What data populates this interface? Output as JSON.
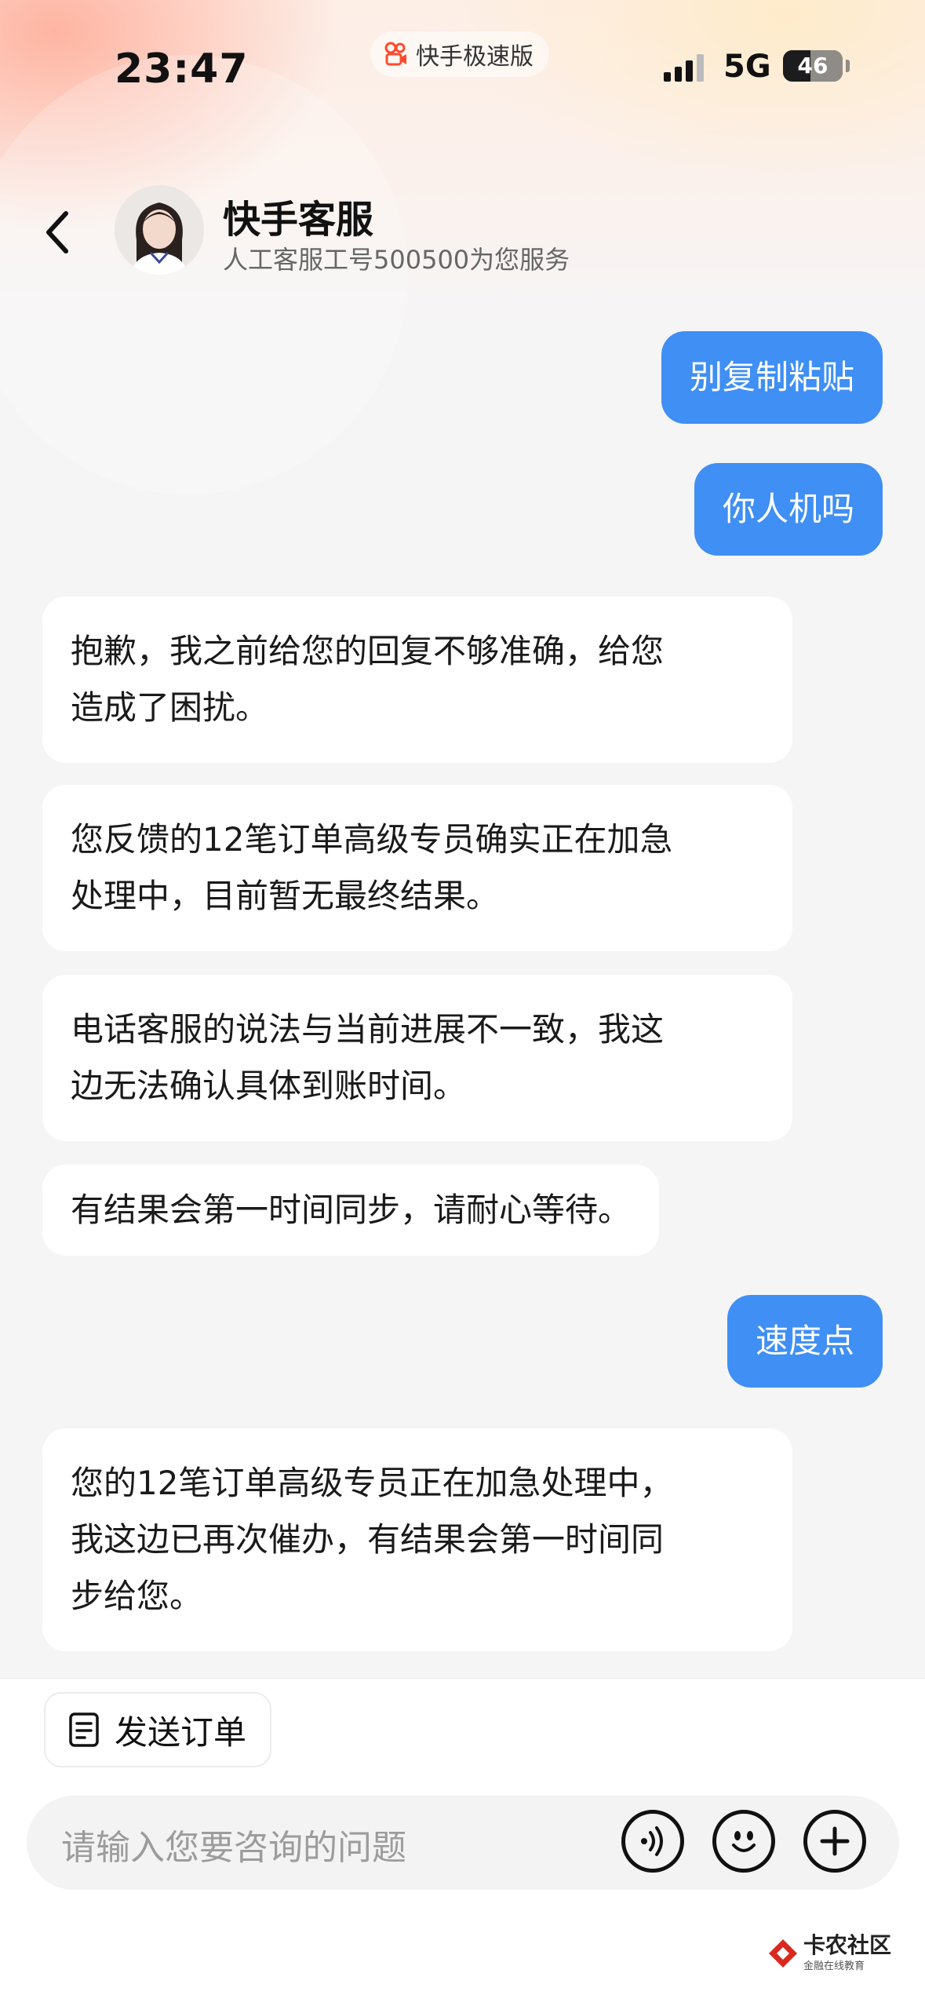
{
  "status_bar": {
    "time": "23:47",
    "app_pill": "快手极速版",
    "network": "5G",
    "battery": "46",
    "battery_level": 0.46
  },
  "header": {
    "agent_name": "快手客服",
    "agent_subtitle": "人工客服工号500500为您服务"
  },
  "messages": [
    {
      "from": "user",
      "text": "别复制粘贴"
    },
    {
      "from": "user",
      "text": "你人机吗"
    },
    {
      "from": "agent",
      "lines": [
        "抱歉，我之前给您的回复不够准确，给您",
        "造成了困扰。"
      ]
    },
    {
      "from": "agent",
      "lines": [
        "您反馈的12笔订单高级专员确实正在加急",
        "处理中，目前暂无最终结果。"
      ]
    },
    {
      "from": "agent",
      "lines": [
        "电话客服的说法与当前进展不一致，我这",
        "边无法确认具体到账时间。"
      ]
    },
    {
      "from": "agent",
      "lines": [
        "有结果会第一时间同步，请耐心等待。"
      ]
    },
    {
      "from": "user",
      "text": "速度点"
    },
    {
      "from": "agent",
      "lines": [
        "您的12笔订单高级专员正在加急处理中，",
        "我这边已再次催办，有结果会第一时间同",
        "步给您。"
      ]
    }
  ],
  "bottom": {
    "send_order_label": "发送订单",
    "input_placeholder": "请输入您要咨询的问题"
  },
  "watermark": {
    "title": "卡农社区",
    "subtitle": "金融在线教育"
  },
  "colors": {
    "user_bubble": "#3f8ff4",
    "agent_bubble": "#ffffff",
    "background": "#f5f5f6"
  }
}
